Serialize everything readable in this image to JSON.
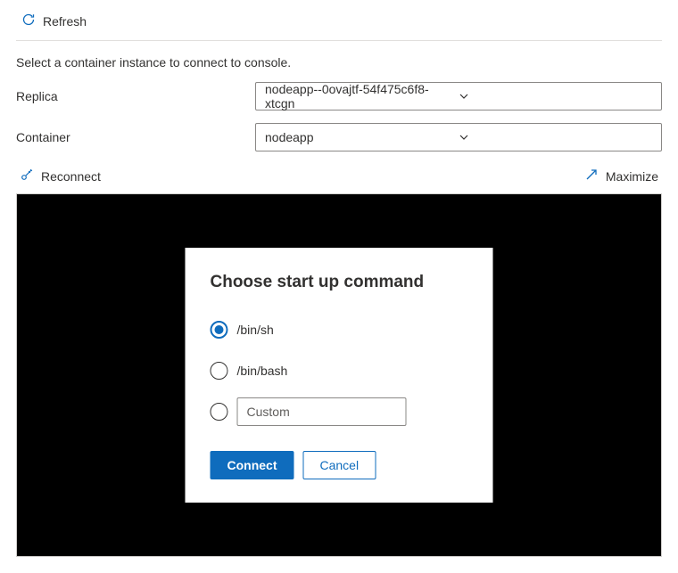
{
  "toolbar": {
    "refresh_label": "Refresh"
  },
  "instruction": "Select a container instance to connect to console.",
  "fields": {
    "replica_label": "Replica",
    "replica_value": "nodeapp--0ovajtf-54f475c6f8-xtcgn",
    "container_label": "Container",
    "container_value": "nodeapp"
  },
  "console_toolbar": {
    "reconnect_label": "Reconnect",
    "maximize_label": "Maximize"
  },
  "dialog": {
    "title": "Choose start up command",
    "option_binsh": "/bin/sh",
    "option_binbash": "/bin/bash",
    "option_custom_placeholder": "Custom",
    "connect_label": "Connect",
    "cancel_label": "Cancel"
  }
}
